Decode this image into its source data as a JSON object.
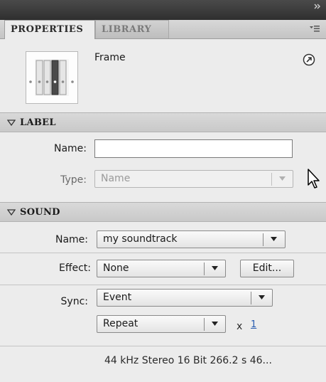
{
  "tabs": [
    {
      "label": "PROPERTIES",
      "active": true
    },
    {
      "label": "LIBRARY",
      "active": false
    }
  ],
  "icons": {
    "collapse": "double-chevron-right-icon",
    "panel_menu": "panel-menu-icon",
    "frame_thumbnail": "frame-thumbnail-icon",
    "help": "help-icon",
    "section_toggle": "disclosure-triangle-icon",
    "cursor": "mouse-pointer-icon"
  },
  "frame": {
    "title": "Frame"
  },
  "label_section": {
    "title": "LABEL",
    "name_label": "Name:",
    "name_value": "",
    "type_label": "Type:",
    "type_value": "Name"
  },
  "sound_section": {
    "title": "SOUND",
    "name_label": "Name:",
    "name_value": "my soundtrack",
    "effect_label": "Effect:",
    "effect_value": "None",
    "edit_button": "Edit...",
    "sync_label": "Sync:",
    "sync_value": "Event",
    "repeat_value": "Repeat",
    "times_symbol": "x",
    "repeat_count": "1",
    "info": "44 kHz Stereo 16 Bit 266.2 s 46..."
  },
  "colors": {
    "panel_bg": "#ececec",
    "titlebar_bg": "#3a3a3a",
    "section_bg": "#d2d2d2",
    "link": "#2a5db0"
  }
}
